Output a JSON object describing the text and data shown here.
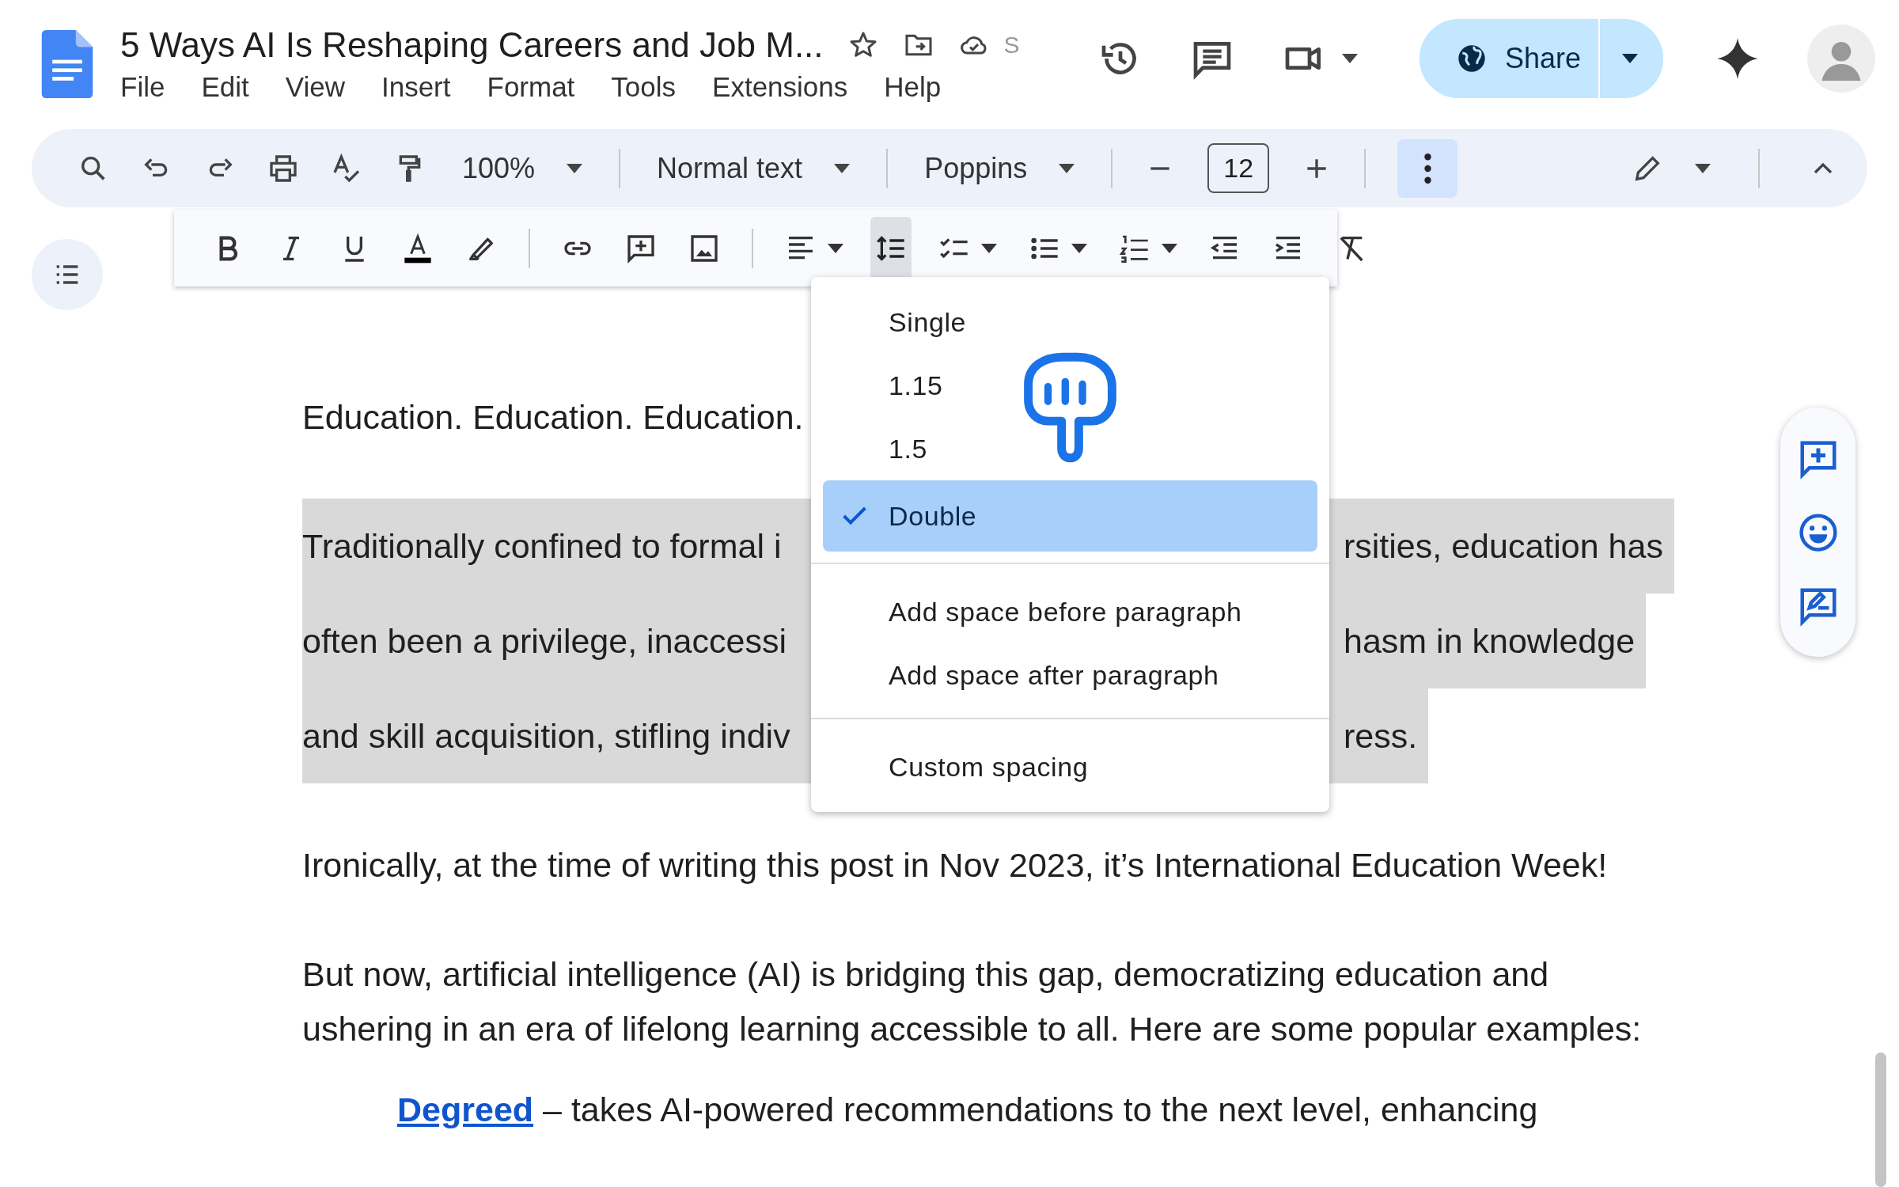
{
  "doc": {
    "title": "5 Ways AI Is Reshaping Careers and Job M...",
    "save_status": "S"
  },
  "menu_bar": [
    "File",
    "Edit",
    "View",
    "Insert",
    "Format",
    "Tools",
    "Extensions",
    "Help"
  ],
  "share_button": {
    "label": "Share"
  },
  "toolbar": {
    "zoom": "100%",
    "style": "Normal text",
    "font": "Poppins",
    "font_size": "12",
    "more_options_open": true
  },
  "format_toolbar": {
    "line_spacing_open": true
  },
  "spacing_menu": {
    "options": [
      {
        "label": "Single",
        "selected": false
      },
      {
        "label": "1.15",
        "selected": false
      },
      {
        "label": "1.5",
        "selected": false
      },
      {
        "label": "Double",
        "selected": true
      }
    ],
    "paragraph_options": [
      "Add space before paragraph",
      "Add space after paragraph"
    ],
    "custom": "Custom spacing"
  },
  "document": {
    "intro": "Education. Education. Education.",
    "selected_lines": [
      {
        "left": "Traditionally confined to formal i",
        "right": "rsities, education has"
      },
      {
        "left": "often been a privilege, inaccessi",
        "right": "hasm in knowledge"
      },
      {
        "left": "and skill acquisition, stifling indiv",
        "right": "ress."
      }
    ],
    "paragraphs": [
      "Ironically, at the time of writing this post in Nov 2023, it’s International Education Week!",
      "But now, artificial intelligence (AI) is bridging this gap, democratizing education and ushering in an era of lifelong learning accessible to all. Here are some popular examples:"
    ],
    "list_item": {
      "link": "Degreed",
      "text": " – takes AI-powered recommendations to the next level, enhancing"
    }
  }
}
